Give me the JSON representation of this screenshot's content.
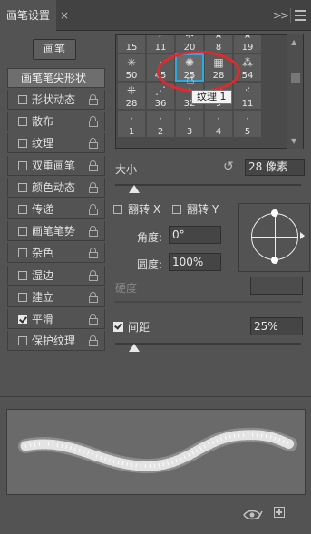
{
  "tab": {
    "title": "画笔设置",
    "close": "×",
    "expand": ">>"
  },
  "brush_button": "画笔",
  "options": {
    "tip_shape": "画笔笔尖形状",
    "items": [
      {
        "label": "形状动态",
        "checked": false
      },
      {
        "label": "散布",
        "checked": false
      },
      {
        "label": "纹理",
        "checked": false
      },
      {
        "label": "双重画笔",
        "checked": false
      },
      {
        "label": "颜色动态",
        "checked": false
      },
      {
        "label": "传递",
        "checked": false
      },
      {
        "label": "画笔笔势",
        "checked": false
      },
      {
        "label": "杂色",
        "checked": false
      },
      {
        "label": "湿边",
        "checked": false
      },
      {
        "label": "建立",
        "checked": false
      },
      {
        "label": "平滑",
        "checked": true
      },
      {
        "label": "保护纹理",
        "checked": false
      }
    ]
  },
  "brush_grid": {
    "rows": [
      [
        {
          "glyph": "⌒",
          "num": "15"
        },
        {
          "glyph": "≁",
          "num": "11"
        },
        {
          "glyph": "✲",
          "num": "20"
        },
        {
          "glyph": "★",
          "num": "8"
        },
        {
          "glyph": "★",
          "num": "19"
        }
      ],
      [
        {
          "glyph": "✳",
          "num": "50"
        },
        {
          "glyph": "·",
          "num": "45"
        },
        {
          "glyph": "✺",
          "num": "25"
        },
        {
          "glyph": "▦",
          "num": "28"
        },
        {
          "glyph": "⁂",
          "num": "54"
        }
      ],
      [
        {
          "glyph": "⁜",
          "num": "28"
        },
        {
          "glyph": "⋰",
          "num": "36"
        },
        {
          "glyph": "◦",
          "num": "32"
        },
        {
          "glyph": "⁘",
          "num": "9"
        },
        {
          "glyph": "⁖",
          "num": "11"
        }
      ],
      [
        {
          "glyph": "·",
          "num": "1"
        },
        {
          "glyph": "·",
          "num": "2"
        },
        {
          "glyph": "·",
          "num": "3"
        },
        {
          "glyph": "·",
          "num": "4"
        },
        {
          "glyph": "·",
          "num": "5"
        }
      ]
    ],
    "selected_index": "1-2",
    "tooltip": "纹理 1"
  },
  "size": {
    "label": "大小",
    "value": "28 像素",
    "slider": 0.1
  },
  "flip_x": "翻转 X",
  "flip_y": "翻转 Y",
  "angle": {
    "label": "角度:",
    "value": "0°"
  },
  "roundness": {
    "label": "圆度:",
    "value": "100%"
  },
  "hardness": {
    "label": "硬度"
  },
  "spacing": {
    "label": "间距",
    "value": "25%",
    "checked": true,
    "slider": 0.1
  },
  "colors": {
    "accent": "#2aa8e0",
    "annotation": "#e6272e",
    "panel": "#535353"
  }
}
